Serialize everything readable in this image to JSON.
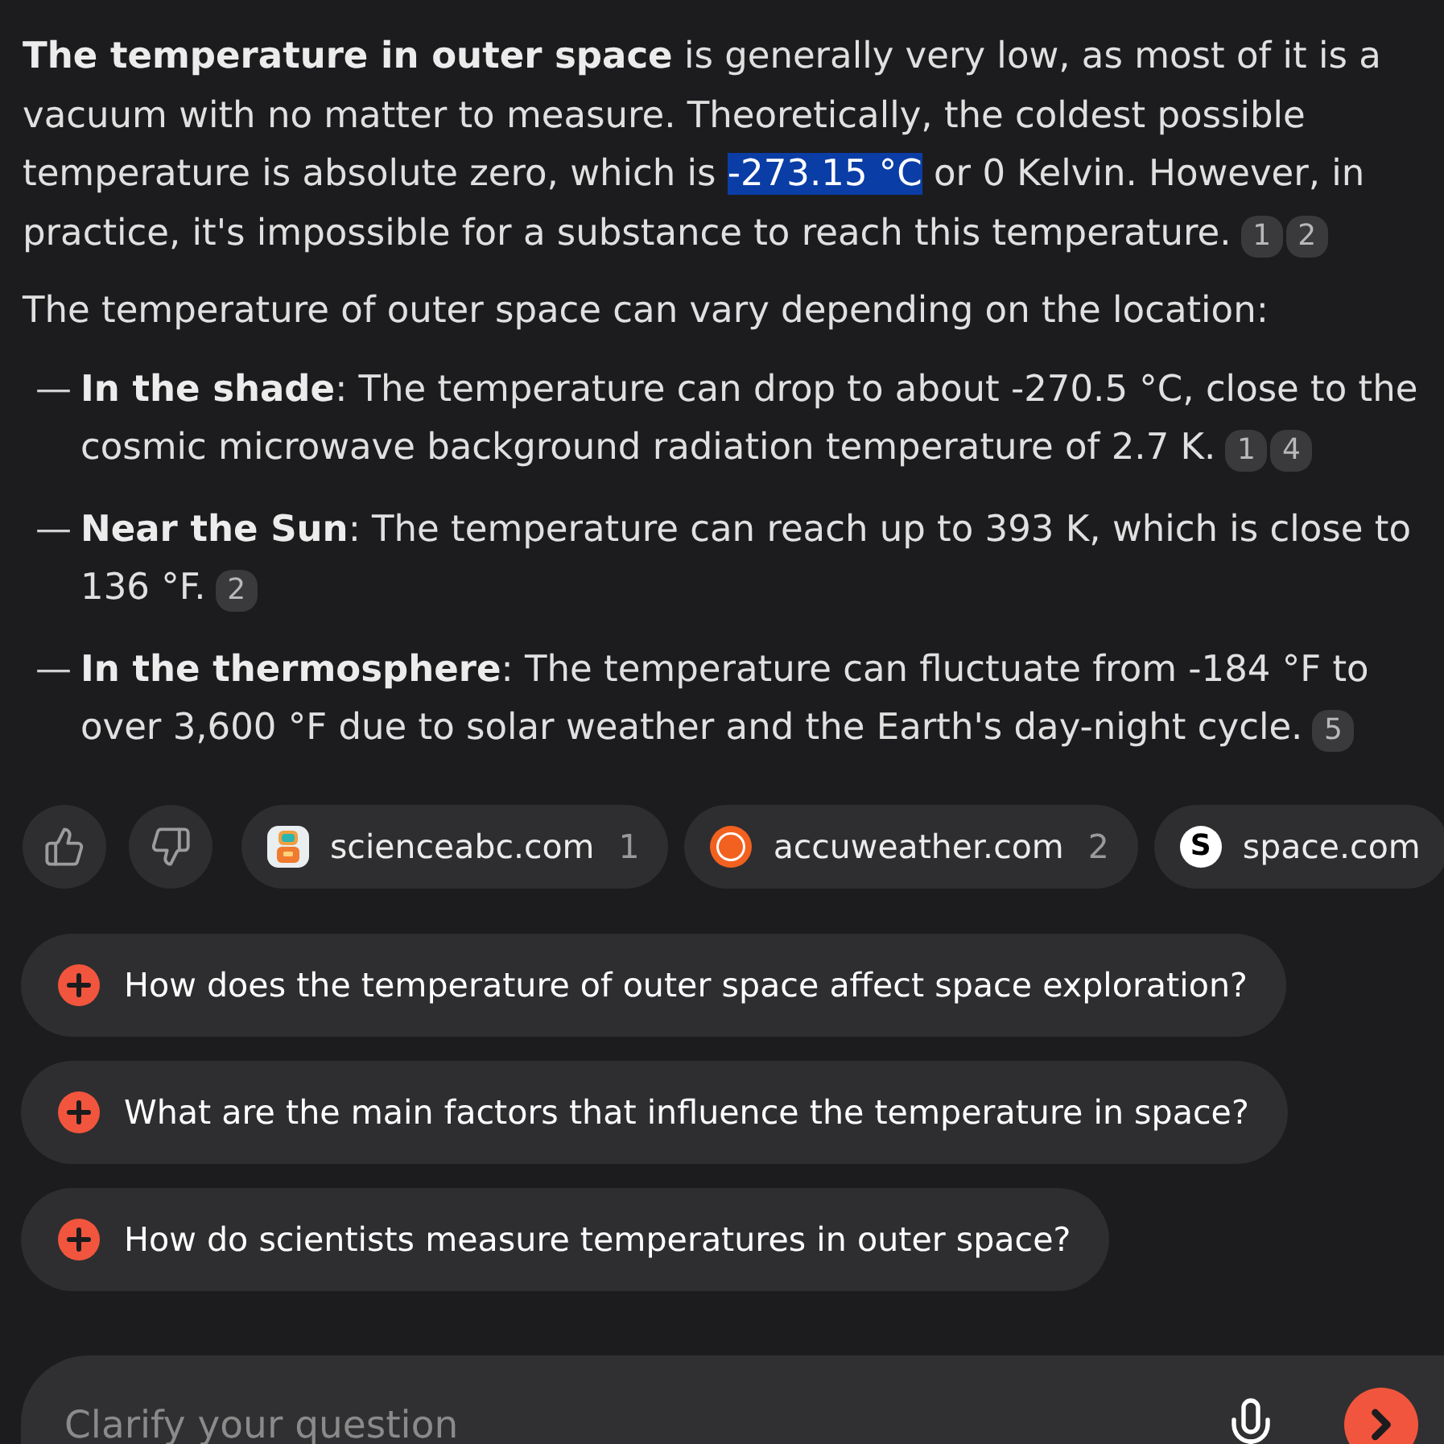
{
  "answer": {
    "intro": {
      "segments": [
        {
          "text": "**The temperature in outer space** is generally very low, as most of it is a vacuum with no matter to measure. Theoretically, the coldest possible temperature is absolute zero, which is",
          "selected": false
        },
        {
          "text": "-273.15 °C",
          "selected": true
        },
        {
          "text": "or 0 Kelvin. However, in practice, it's impossible for a substance to reach this temperature.",
          "selected": false
        }
      ],
      "citations": [
        "1",
        "2"
      ]
    },
    "lead": {
      "text": "The temperature of outer space can vary depending on the location:"
    },
    "items": [
      {
        "marker": "—",
        "text": "**In the shade**: The temperature can drop to about -270.5 °C, close to the cosmic microwave background radiation temperature of 2.7 K.",
        "citations": [
          "1",
          "4"
        ]
      },
      {
        "marker": "—",
        "text": "**Near the Sun**: The temperature can reach up to 393 K, which is close to 136 °F.",
        "citations": [
          "2"
        ]
      },
      {
        "marker": "—",
        "text": "**In the thermosphere**: The temperature can fluctuate from -184 °F to over 3,600 °F due to solar weather and the Earth's day-night cycle.",
        "citations": [
          "5"
        ]
      }
    ]
  },
  "sources": [
    {
      "kind": "robot",
      "domain": "scienceabc.com",
      "count": "1"
    },
    {
      "kind": "sun",
      "domain": "accuweather.com",
      "count": "2"
    },
    {
      "kind": "letter",
      "letter": "S",
      "domain": "space.com"
    }
  ],
  "suggestions": [
    {
      "text": "How does the temperature of outer space affect space exploration?"
    },
    {
      "text": "What are the main factors that influence the temperature in space?"
    },
    {
      "text": "How do scientists measure temperatures in outer space?"
    }
  ],
  "input": {
    "placeholder": "Clarify your question"
  }
}
